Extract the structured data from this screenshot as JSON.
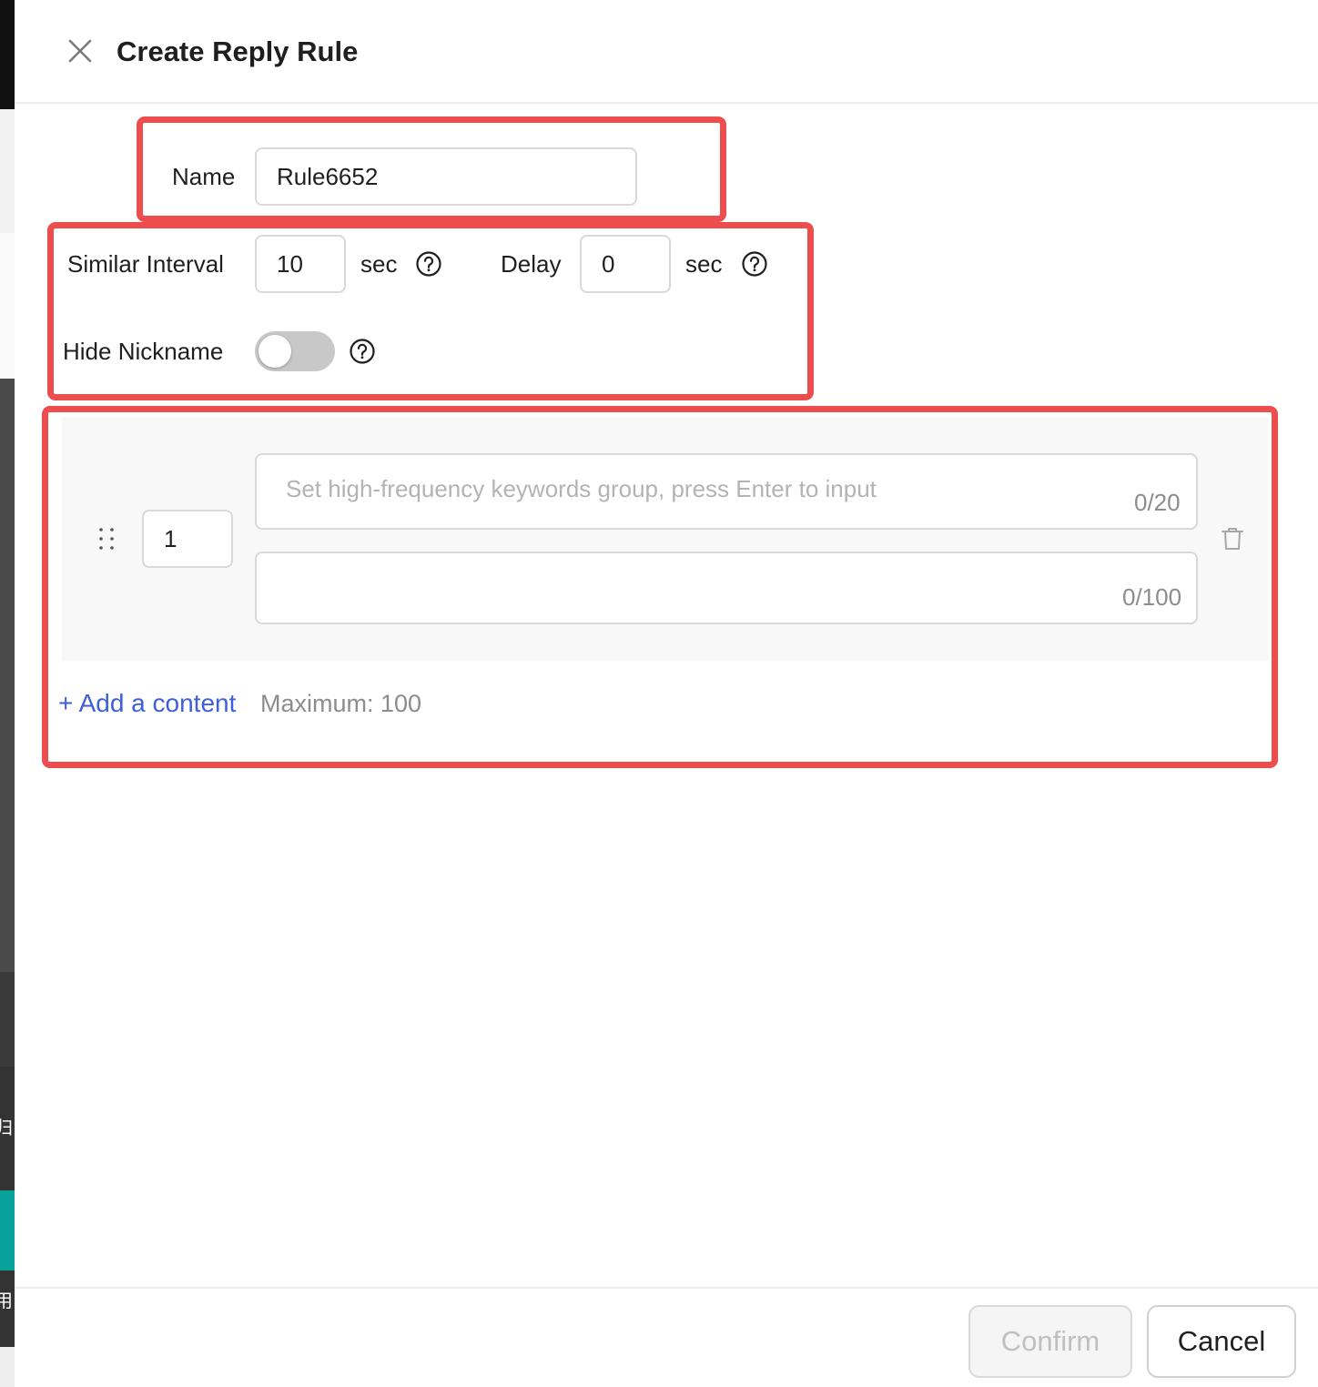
{
  "background": {
    "glyph_1": "归",
    "glyph_2": "用",
    "accent_color": "#07a39a"
  },
  "header": {
    "title": "Create Reply Rule",
    "close_icon": "close-icon"
  },
  "form": {
    "name": {
      "label": "Name",
      "value": "Rule6652"
    },
    "similar_interval": {
      "label": "Similar Interval",
      "value": "10",
      "unit": "sec",
      "help_icon": "question-circle-icon"
    },
    "delay": {
      "label": "Delay",
      "value": "0",
      "unit": "sec",
      "help_icon": "question-circle-icon"
    },
    "hide_nickname": {
      "label": "Hide Nickname",
      "enabled": false,
      "help_icon": "question-circle-icon"
    }
  },
  "content_items": [
    {
      "index": "1",
      "keywords_placeholder": "Set high-frequency keywords group, press Enter to input",
      "keywords_counter": "0/20",
      "reply_value": "",
      "reply_counter": "0/100"
    }
  ],
  "add_content": {
    "label": "+ Add a content",
    "max_note": "Maximum: 100"
  },
  "footer": {
    "confirm_label": "Confirm",
    "cancel_label": "Cancel",
    "confirm_disabled": true
  },
  "colors": {
    "highlight": "#ee4d4d",
    "link": "#3d5fd8",
    "toggle_off": "#c8c8c8"
  }
}
